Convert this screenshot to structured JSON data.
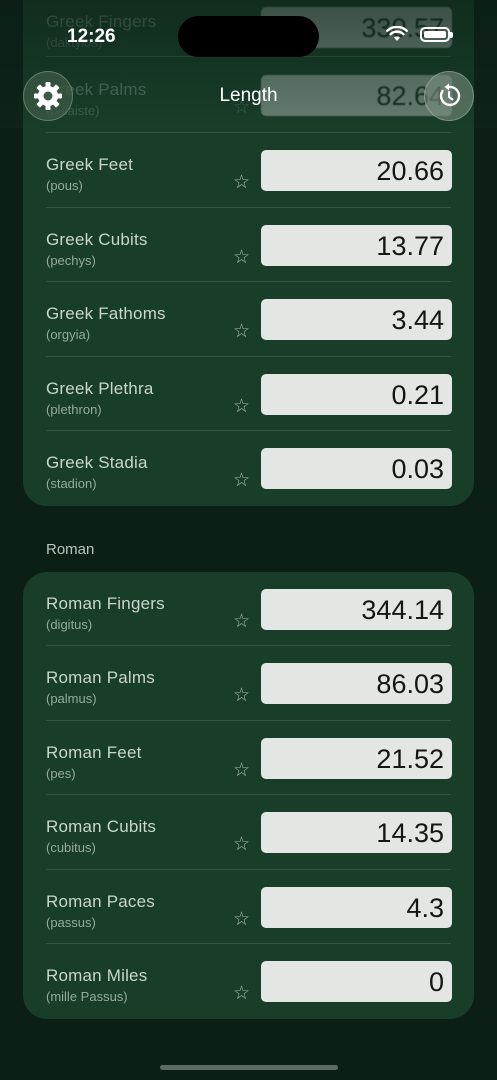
{
  "status_bar": {
    "time": "12:26"
  },
  "nav": {
    "title": "Length"
  },
  "greek": {
    "rows": [
      {
        "name": "Greek Fingers",
        "sub": "(daktylos)",
        "value": "330.57"
      },
      {
        "name": "Greek Palms",
        "sub": "(palaiste)",
        "value": "82.64"
      },
      {
        "name": "Greek Feet",
        "sub": "(pous)",
        "value": "20.66"
      },
      {
        "name": "Greek Cubits",
        "sub": "(pechys)",
        "value": "13.77"
      },
      {
        "name": "Greek Fathoms",
        "sub": "(orgyia)",
        "value": "3.44"
      },
      {
        "name": "Greek Plethra",
        "sub": "(plethron)",
        "value": "0.21"
      },
      {
        "name": "Greek Stadia",
        "sub": "(stadion)",
        "value": "0.03"
      }
    ]
  },
  "roman": {
    "section_label": "Roman",
    "rows": [
      {
        "name": "Roman Fingers",
        "sub": "(digitus)",
        "value": "344.14"
      },
      {
        "name": "Roman Palms",
        "sub": "(palmus)",
        "value": "86.03"
      },
      {
        "name": "Roman Feet",
        "sub": "(pes)",
        "value": "21.52"
      },
      {
        "name": "Roman Cubits",
        "sub": "(cubitus)",
        "value": "14.35"
      },
      {
        "name": "Roman Paces",
        "sub": "(passus)",
        "value": "4.3"
      },
      {
        "name": "Roman Miles",
        "sub": "(mille Passus)",
        "value": "0"
      }
    ]
  },
  "icons": {
    "favorite": "☆",
    "settings": "gear-icon",
    "reset": "reset-icon"
  }
}
